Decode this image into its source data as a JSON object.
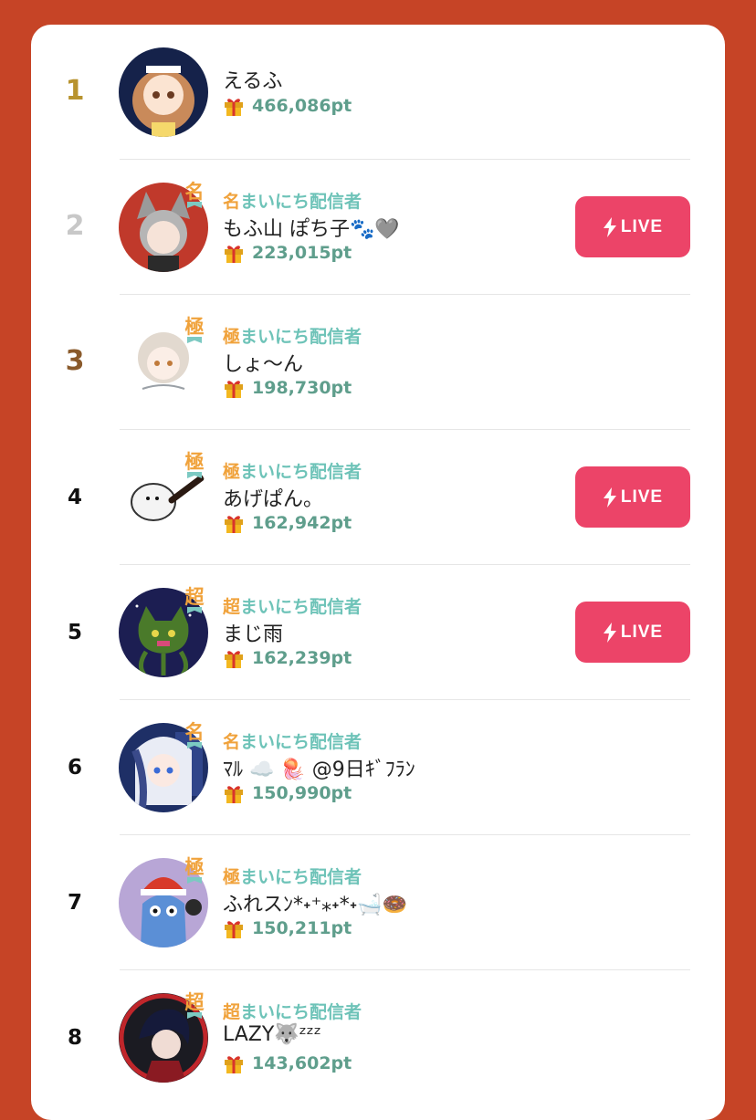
{
  "colors": {
    "background": "#c64426",
    "card": "#ffffff",
    "live_button": "#ec4468",
    "points_text": "#5f9e8c",
    "badge_orange": "#f0a23b",
    "badge_teal": "#6ec3b8",
    "rank_1": "#b8932e",
    "rank_2": "#c8c8c8",
    "rank_3": "#8a5a2b"
  },
  "live_label": "LIVE",
  "ranking": [
    {
      "rank": "1",
      "name": "えるふ",
      "badge_tier": "",
      "badge_rest": "",
      "points": "466,086pt",
      "live": false,
      "avatar": "girl-brown-hair-icon"
    },
    {
      "rank": "2",
      "name": "もふ山 ぽち子🐾🩶",
      "badge_tier": "名",
      "badge_rest": "まいにち配信者",
      "points": "223,015pt",
      "live": true,
      "avatar": "wolf-girl-icon"
    },
    {
      "rank": "3",
      "name": "しょ〜ん",
      "badge_tier": "極",
      "badge_rest": "まいにち配信者",
      "points": "198,730pt",
      "live": false,
      "avatar": "sketch-boy-icon"
    },
    {
      "rank": "4",
      "name": "あげぱん。",
      "badge_tier": "極",
      "badge_rest": "まいにち配信者",
      "points": "162,942pt",
      "live": true,
      "avatar": "white-bird-icon"
    },
    {
      "rank": "5",
      "name": "まじ雨",
      "badge_tier": "超",
      "badge_rest": "まいにち配信者",
      "points": "162,239pt",
      "live": true,
      "avatar": "green-monster-icon"
    },
    {
      "rank": "6",
      "name": "ﾏﾙ ☁️ 🪼 @9日ｷﾞﾌﾗﾝ",
      "badge_tier": "名",
      "badge_rest": "まいにち配信者",
      "points": "150,990pt",
      "live": false,
      "avatar": "blue-hair-girl-icon"
    },
    {
      "rank": "7",
      "name": "ふれスﾝ*˖⁺⁎˖*˖🛁🍩",
      "badge_tier": "極",
      "badge_rest": "まいにち配信者",
      "points": "150,211pt",
      "live": false,
      "avatar": "santa-blue-monster-icon"
    },
    {
      "rank": "8",
      "name": "LAZY🐺ᶻᶻᶻ",
      "badge_tier": "超",
      "badge_rest": "まいにち配信者",
      "points": "143,602pt",
      "live": false,
      "avatar": "dark-hair-boy-icon"
    }
  ]
}
